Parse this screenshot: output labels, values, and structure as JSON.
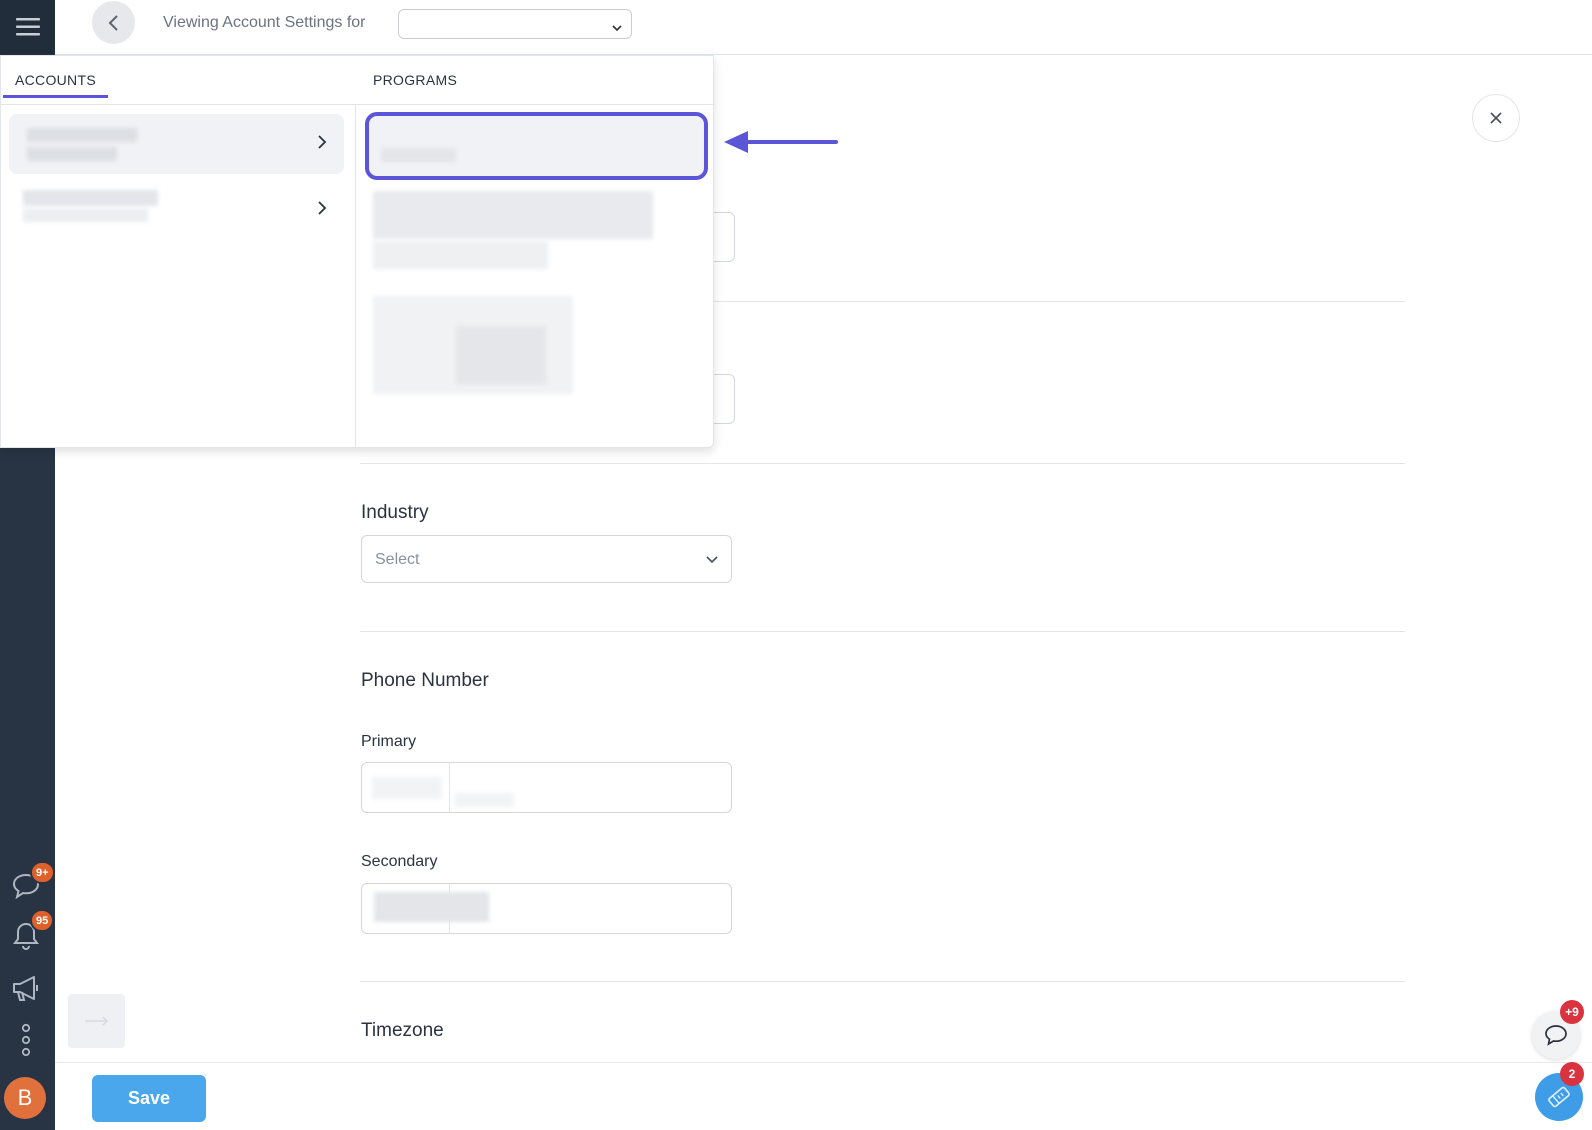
{
  "header": {
    "viewing_label": "Viewing Account Settings for",
    "account_select_value": ""
  },
  "dropdown": {
    "accounts_tab": "ACCOUNTS",
    "programs_tab": "PROGRAMS",
    "accounts": [
      {
        "label": "",
        "selected": true
      },
      {
        "label": "",
        "selected": false
      }
    ],
    "programs": [
      {
        "label": "",
        "highlighted": true
      }
    ]
  },
  "form": {
    "industry_label": "Industry",
    "industry_placeholder": "Select",
    "phone_section_label": "Phone Number",
    "primary_label": "Primary",
    "secondary_label": "Secondary",
    "timezone_label": "Timezone"
  },
  "sidebar": {
    "chat_badge": "9+",
    "notifications_badge": "95",
    "avatar_initial": "B"
  },
  "footer": {
    "save_label": "Save"
  },
  "floating": {
    "chat_badge": "+9",
    "tickets_badge": "2"
  },
  "colors": {
    "accent": "#5b55d8",
    "save_button": "#4aa7ec",
    "sidebar": "#283444",
    "badge_orange": "#e0602b",
    "badge_red": "#d9333f"
  }
}
